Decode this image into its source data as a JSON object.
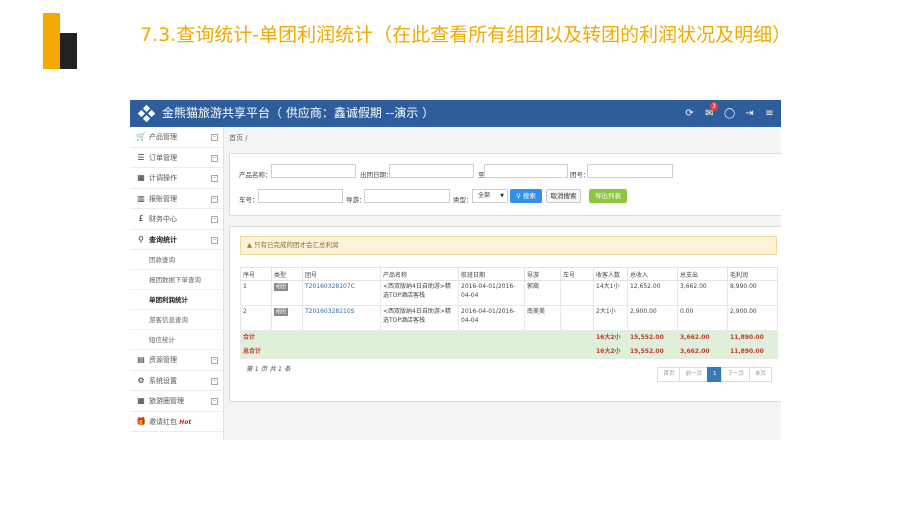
{
  "slide": {
    "title": "7.3.查询统计-单团利润统计（在此查看所有组团以及转团的利润状况及明细）"
  },
  "app": {
    "brand": "金熊猫旅游共享平台（ 供应商：鑫诚假期 --演示 ）",
    "notification_count": "3"
  },
  "sidebar": {
    "items": [
      {
        "label": "产品管理",
        "icon": "cart-icon"
      },
      {
        "label": "订单管理",
        "icon": "list-icon"
      },
      {
        "label": "计调操作",
        "icon": "calendar-icon"
      },
      {
        "label": "报账管理",
        "icon": "chart-icon"
      },
      {
        "label": "财务中心",
        "icon": "pound-icon"
      },
      {
        "label": "查询统计",
        "icon": "search-icon"
      }
    ],
    "sub_items": [
      "团款查询",
      "报团数据下单查询",
      "单团利润统计",
      "游客信息查询",
      "短信统计"
    ],
    "bottom_items": [
      {
        "label": "资源管理",
        "icon": "server-icon"
      },
      {
        "label": "系统设置",
        "icon": "gear-icon"
      },
      {
        "label": "旅游圈管理",
        "icon": "calendar-icon"
      },
      {
        "label": "邀请红包",
        "icon": "gift-icon"
      }
    ],
    "hot_label": "Hot"
  },
  "breadcrumb": "首页 /",
  "search": {
    "product_name_label": "产品名称：",
    "depart_date_label": "出团日期：",
    "to_label": "至",
    "group_no_label": "团号：",
    "plate_label": "车号：",
    "guide_label": "导游：",
    "type_label": "类型：",
    "type_value": "全部",
    "search_button": "搜索",
    "cancel_button": "取消搜索",
    "export_button": "导出列表"
  },
  "alert": "只有已完成的团才会汇总利润",
  "table": {
    "headers": [
      "序号",
      "类型",
      "团号",
      "产品名称",
      "航班日期",
      "导游",
      "车号",
      "收客人数",
      "总收入",
      "总支出",
      "毛利润"
    ],
    "rows": [
      {
        "index": "1",
        "type": "组团",
        "group_no": "T20160328107C",
        "product": "<西双版纳4日自助游>精选TOP酒店客栈",
        "date": "2016-04-01/2016-04-04",
        "guide": "郭嵩",
        "plate": "",
        "pax": "14大1小",
        "income": "12,652.00",
        "expense": "3,662.00",
        "profit": "8,990.00"
      },
      {
        "index": "2",
        "type": "组团",
        "group_no": "T20160328210S",
        "product": "<西双版纳4日自助游>精选TOP酒店客栈",
        "date": "2016-04-01/2016-04-04",
        "guide": "南美美",
        "plate": "",
        "pax": "2大1小",
        "income": "2,900.00",
        "expense": "0.00",
        "profit": "2,900.00"
      }
    ],
    "subtotal": {
      "label": "合计",
      "pax": "16大2小",
      "income": "15,552.00",
      "expense": "3,662.00",
      "profit": "11,890.00"
    },
    "total": {
      "label": "总合计",
      "pax": "16大2小",
      "income": "15,552.00",
      "expense": "3,662.00",
      "profit": "11,890.00"
    }
  },
  "pagination": {
    "info": "第 1 页 共 1 条",
    "first": "首页",
    "prev": "前一页",
    "current": "1",
    "next": "下一页",
    "last": "末页"
  }
}
